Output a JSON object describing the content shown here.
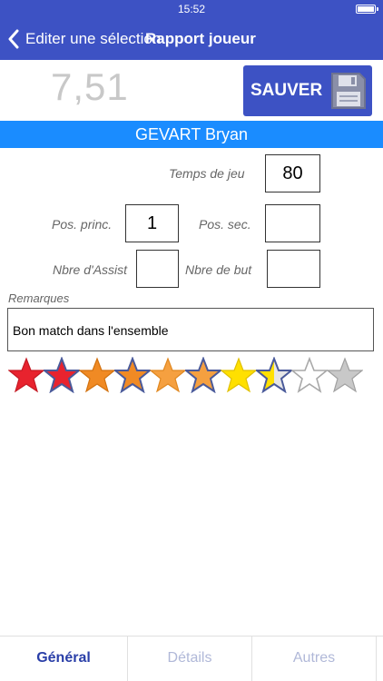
{
  "status_bar": {
    "time": "15:52"
  },
  "nav": {
    "back_label": "Editer une sélection",
    "title": "Rapport joueur"
  },
  "score": "7,51",
  "save_button": {
    "label": "SAUVER"
  },
  "player_name": "GEVART Bryan",
  "fields": {
    "temps_de_jeu": {
      "label": "Temps de jeu",
      "value": "80"
    },
    "pos_princ": {
      "label": "Pos. princ.",
      "value": "1"
    },
    "pos_sec": {
      "label": "Pos. sec.",
      "value": ""
    },
    "nbre_assist": {
      "label": "Nbre d'Assist",
      "value": ""
    },
    "nbre_but": {
      "label": "Nbre de but",
      "value": ""
    }
  },
  "remarks": {
    "label": "Remarques",
    "value": "Bon match dans l'ensemble"
  },
  "rating": {
    "value": 7.5,
    "max": 10
  },
  "tabs": [
    {
      "label": "Général",
      "active": true
    },
    {
      "label": "Détails",
      "active": false
    },
    {
      "label": "Autres",
      "active": false
    }
  ],
  "colors": {
    "nav_blue": "#3d52c4",
    "player_bar": "#1a8cff",
    "star_red": "#e8232e",
    "star_orange": "#f08a24",
    "star_yellow": "#ffe000",
    "star_gray": "#c0c0c0"
  }
}
